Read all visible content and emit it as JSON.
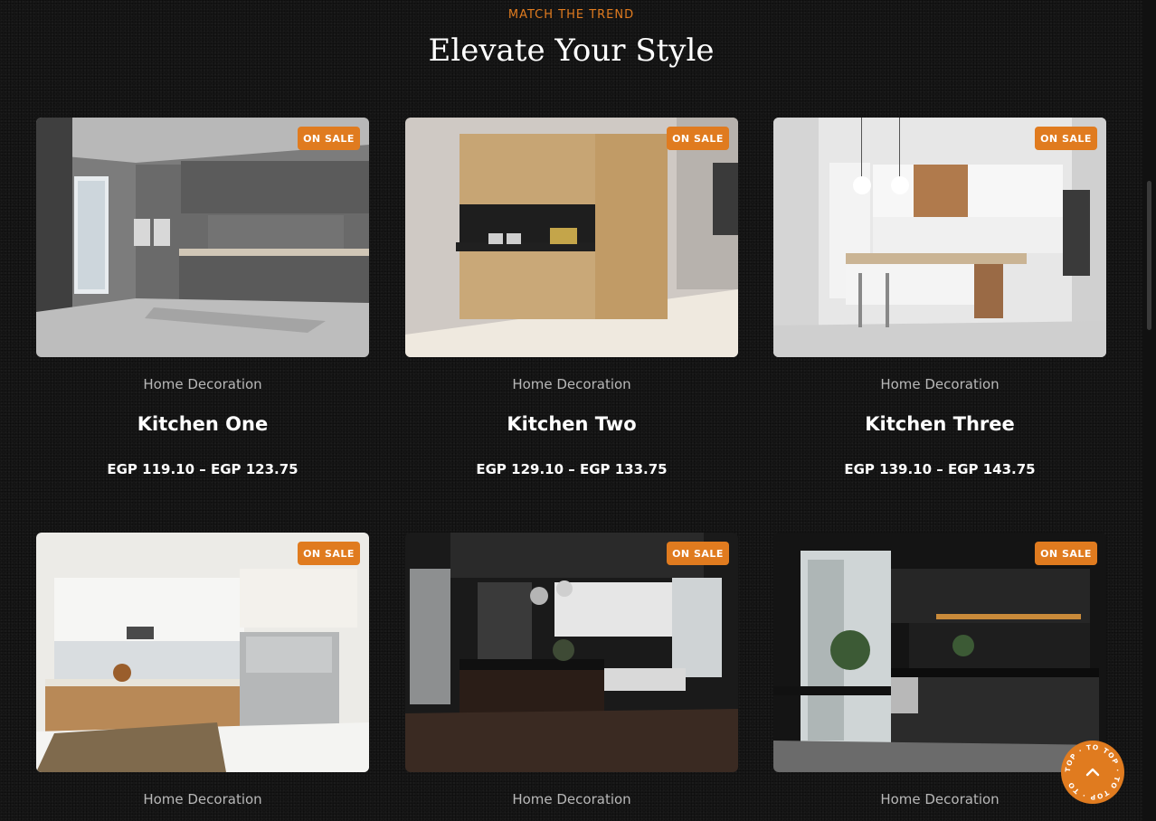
{
  "section": {
    "eyebrow": "MATCH THE TREND",
    "title": "Elevate Your Style"
  },
  "badge_label": "ON SALE",
  "products": [
    {
      "category": "Home Decoration",
      "name": "Kitchen One",
      "price": "EGP 119.10 – EGP 123.75"
    },
    {
      "category": "Home Decoration",
      "name": "Kitchen Two",
      "price": "EGP 129.10 – EGP 133.75"
    },
    {
      "category": "Home Decoration",
      "name": "Kitchen Three",
      "price": "EGP 139.10 – EGP 143.75"
    },
    {
      "category": "Home Decoration",
      "name": "",
      "price": ""
    },
    {
      "category": "Home Decoration",
      "name": "",
      "price": ""
    },
    {
      "category": "Home Decoration",
      "name": "",
      "price": ""
    }
  ],
  "back_to_top": {
    "ring_text": "TOP · TO TOP · TO TOP · TO",
    "icon": "chevron-up-icon"
  },
  "colors": {
    "accent": "#e07b1f",
    "background": "#161616"
  }
}
